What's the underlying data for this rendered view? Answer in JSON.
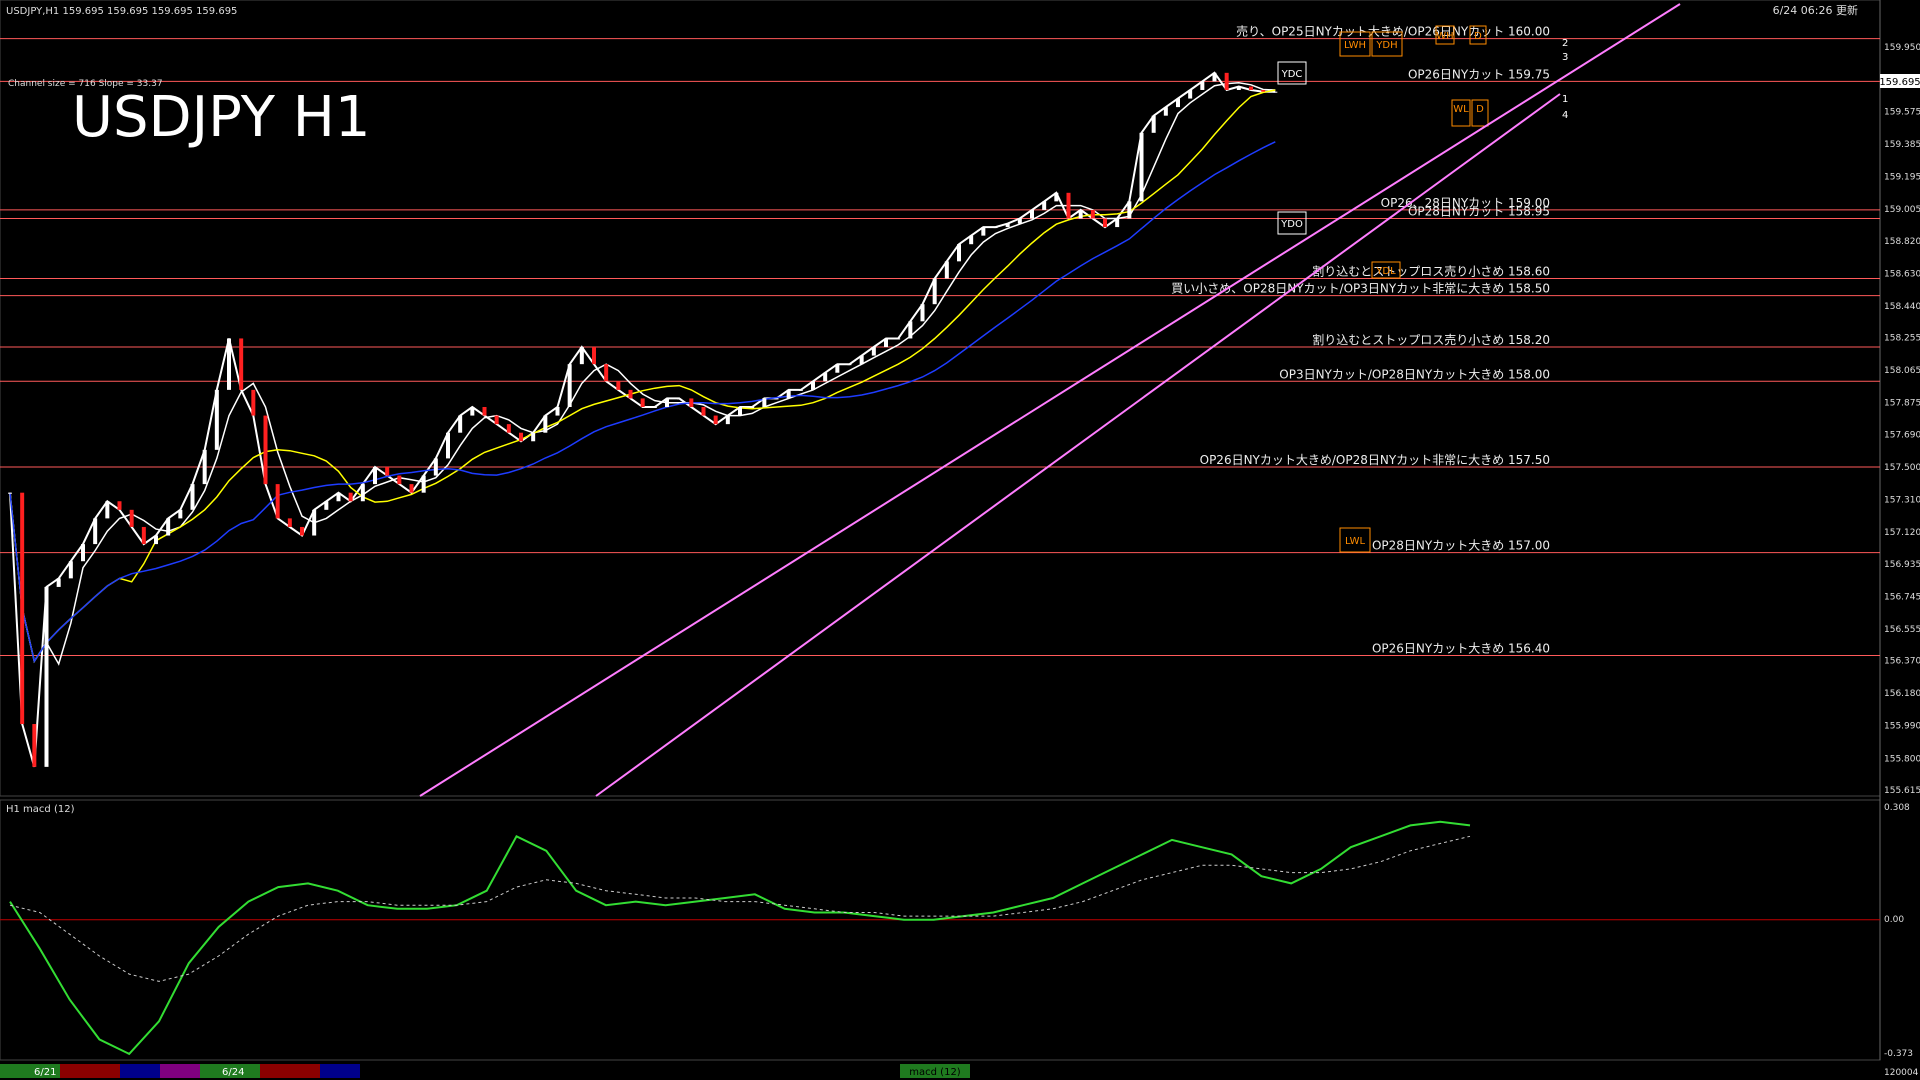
{
  "header": {
    "symbol_info": "USDJPY,H1  159.695 159.695 159.695 159.695",
    "timestamp": "6/24 06:26 更新",
    "channel_info": "Channel size = 716 Slope = 33.37",
    "big_title": "USDJPY H1"
  },
  "chart_data": {
    "type": "line",
    "title": "USDJPY H1",
    "price_axis": {
      "ylim": [
        155.615,
        160.05
      ],
      "ticks": [
        "159.950",
        "159.760",
        "159.575",
        "159.385",
        "159.195",
        "159.005",
        "158.820",
        "158.630",
        "158.440",
        "158.255",
        "158.065",
        "157.875",
        "157.690",
        "157.500",
        "157.310",
        "157.120",
        "156.935",
        "156.745",
        "156.555",
        "156.370",
        "156.180",
        "155.990",
        "155.800",
        "155.615"
      ],
      "current_price": "159.695"
    },
    "levels": [
      {
        "price": 160.0,
        "text": "売り、OP25日NYカット大きめ/OP26日NYカット 160.00",
        "color": "#ff5a5a"
      },
      {
        "price": 159.75,
        "text": "OP26日NYカット 159.75",
        "color": "#ff5a5a"
      },
      {
        "price": 159.0,
        "text": "OP26、28日NYカット 159.00",
        "color": "#ff5a5a"
      },
      {
        "price": 158.95,
        "text": "OP28日NYカット 158.95",
        "color": "#ff5a5a"
      },
      {
        "price": 158.6,
        "text": "割り込むとストップロス売り小さめ 158.60",
        "color": "#ff5a5a"
      },
      {
        "price": 158.5,
        "text": "買い小さめ、OP28日NYカット/OP3日NYカット非常に大きめ 158.50",
        "color": "#ff5a5a"
      },
      {
        "price": 158.2,
        "text": "割り込むとストップロス売り小さめ 158.20",
        "color": "#ff5a5a"
      },
      {
        "price": 158.0,
        "text": "OP3日NYカット/OP28日NYカット大きめ 158.00",
        "color": "#ff5a5a"
      },
      {
        "price": 157.5,
        "text": "OP26日NYカット大きめ/OP28日NYカット非常に大きめ 157.50",
        "color": "#ff5a5a"
      },
      {
        "price": 157.0,
        "text": "OP28日NYカット大きめ 157.00",
        "color": "#ff5a5a"
      },
      {
        "price": 156.4,
        "text": "OP26日NYカット大きめ 156.40",
        "color": "#ff5a5a"
      }
    ],
    "price_series": [
      {
        "name": "close",
        "color": "#ffffff",
        "x": [
          0,
          10,
          20,
          30,
          40,
          50,
          60,
          70,
          80,
          90,
          100,
          110,
          120,
          130,
          140,
          150,
          160,
          170,
          180,
          190,
          200,
          210,
          220,
          230,
          240,
          250,
          260,
          270,
          280,
          290,
          300,
          310,
          320,
          330,
          340,
          350,
          360,
          370,
          380,
          390,
          400,
          410,
          420,
          430,
          440,
          450,
          460,
          470,
          480,
          490,
          500,
          510,
          520,
          530,
          540,
          550,
          560,
          570,
          580,
          590,
          600,
          610,
          620,
          630,
          640,
          650,
          660,
          670,
          680,
          690,
          700,
          710,
          720,
          730,
          740,
          750,
          760,
          770,
          780,
          790,
          800,
          810,
          820,
          830,
          840,
          850,
          860,
          870,
          880,
          890,
          900,
          910,
          920,
          930,
          940,
          950,
          960,
          970,
          980,
          990,
          1000,
          1010,
          1020,
          1030,
          1040,
          1050,
          1060,
          1070,
          1080,
          1090,
          1100,
          1110,
          1120,
          1130,
          1140,
          1150,
          1160,
          1170,
          1180,
          1190,
          1200
        ],
        "values": [
          157.35,
          156.0,
          155.75,
          156.8,
          156.85,
          156.95,
          157.05,
          157.2,
          157.3,
          157.25,
          157.15,
          157.05,
          157.1,
          157.2,
          157.25,
          157.4,
          157.6,
          157.95,
          158.25,
          157.95,
          157.8,
          157.4,
          157.2,
          157.15,
          157.1,
          157.25,
          157.3,
          157.35,
          157.3,
          157.4,
          157.5,
          157.45,
          157.4,
          157.35,
          157.45,
          157.55,
          157.7,
          157.8,
          157.85,
          157.8,
          157.75,
          157.7,
          157.65,
          157.7,
          157.8,
          157.85,
          158.1,
          158.2,
          158.1,
          158.0,
          157.95,
          157.9,
          157.85,
          157.85,
          157.9,
          157.9,
          157.85,
          157.8,
          157.75,
          157.8,
          157.85,
          157.85,
          157.9,
          157.9,
          157.95,
          157.95,
          158.0,
          158.05,
          158.1,
          158.1,
          158.15,
          158.2,
          158.25,
          158.25,
          158.35,
          158.45,
          158.6,
          158.7,
          158.8,
          158.85,
          158.9,
          158.9,
          158.92,
          158.95,
          159.0,
          159.05,
          159.1,
          158.95,
          159.0,
          158.95,
          158.9,
          158.95,
          159.05,
          159.45,
          159.55,
          159.6,
          159.65,
          159.7,
          159.75,
          159.8,
          159.7,
          159.72,
          159.7,
          159.69,
          159.69
        ]
      },
      {
        "name": "ma-short",
        "color": "#ffffff"
      },
      {
        "name": "ma-mid",
        "color": "#ffff00"
      },
      {
        "name": "ma-long",
        "color": "#1e3cff"
      }
    ],
    "markers": [
      "YDC",
      "LWH",
      "YDH",
      "WH",
      "D",
      "WL",
      "D",
      "YDO",
      "YDL",
      "LWL",
      "1",
      "2",
      "3",
      "4"
    ],
    "x_labels": [
      "6/21",
      "6/24"
    ],
    "subchart": {
      "title": "H1  macd (12)",
      "ylim": [
        -0.373,
        0.308
      ],
      "ticks": [
        "0.308",
        "0.00",
        "-0.373"
      ],
      "macd": [
        0.05,
        -0.08,
        -0.22,
        -0.33,
        -0.37,
        -0.28,
        -0.12,
        -0.02,
        0.05,
        0.09,
        0.1,
        0.08,
        0.04,
        0.03,
        0.03,
        0.04,
        0.08,
        0.23,
        0.19,
        0.08,
        0.04,
        0.05,
        0.04,
        0.05,
        0.06,
        0.07,
        0.03,
        0.02,
        0.02,
        0.01,
        0.0,
        0.0,
        0.01,
        0.02,
        0.04,
        0.06,
        0.1,
        0.14,
        0.18,
        0.22,
        0.2,
        0.18,
        0.12,
        0.1,
        0.14,
        0.2,
        0.23,
        0.26,
        0.27,
        0.26
      ],
      "signal": [
        0.04,
        0.02,
        -0.04,
        -0.1,
        -0.15,
        -0.17,
        -0.15,
        -0.1,
        -0.04,
        0.01,
        0.04,
        0.05,
        0.05,
        0.04,
        0.04,
        0.04,
        0.05,
        0.09,
        0.11,
        0.1,
        0.08,
        0.07,
        0.06,
        0.06,
        0.05,
        0.05,
        0.04,
        0.03,
        0.02,
        0.02,
        0.01,
        0.01,
        0.01,
        0.01,
        0.02,
        0.03,
        0.05,
        0.08,
        0.11,
        0.13,
        0.15,
        0.15,
        0.14,
        0.13,
        0.13,
        0.14,
        0.16,
        0.19,
        0.21,
        0.23
      ]
    },
    "footer": {
      "left_label": "6/21",
      "mid_label": "6/24",
      "status": "macd (12)",
      "right_text": "120004"
    }
  }
}
